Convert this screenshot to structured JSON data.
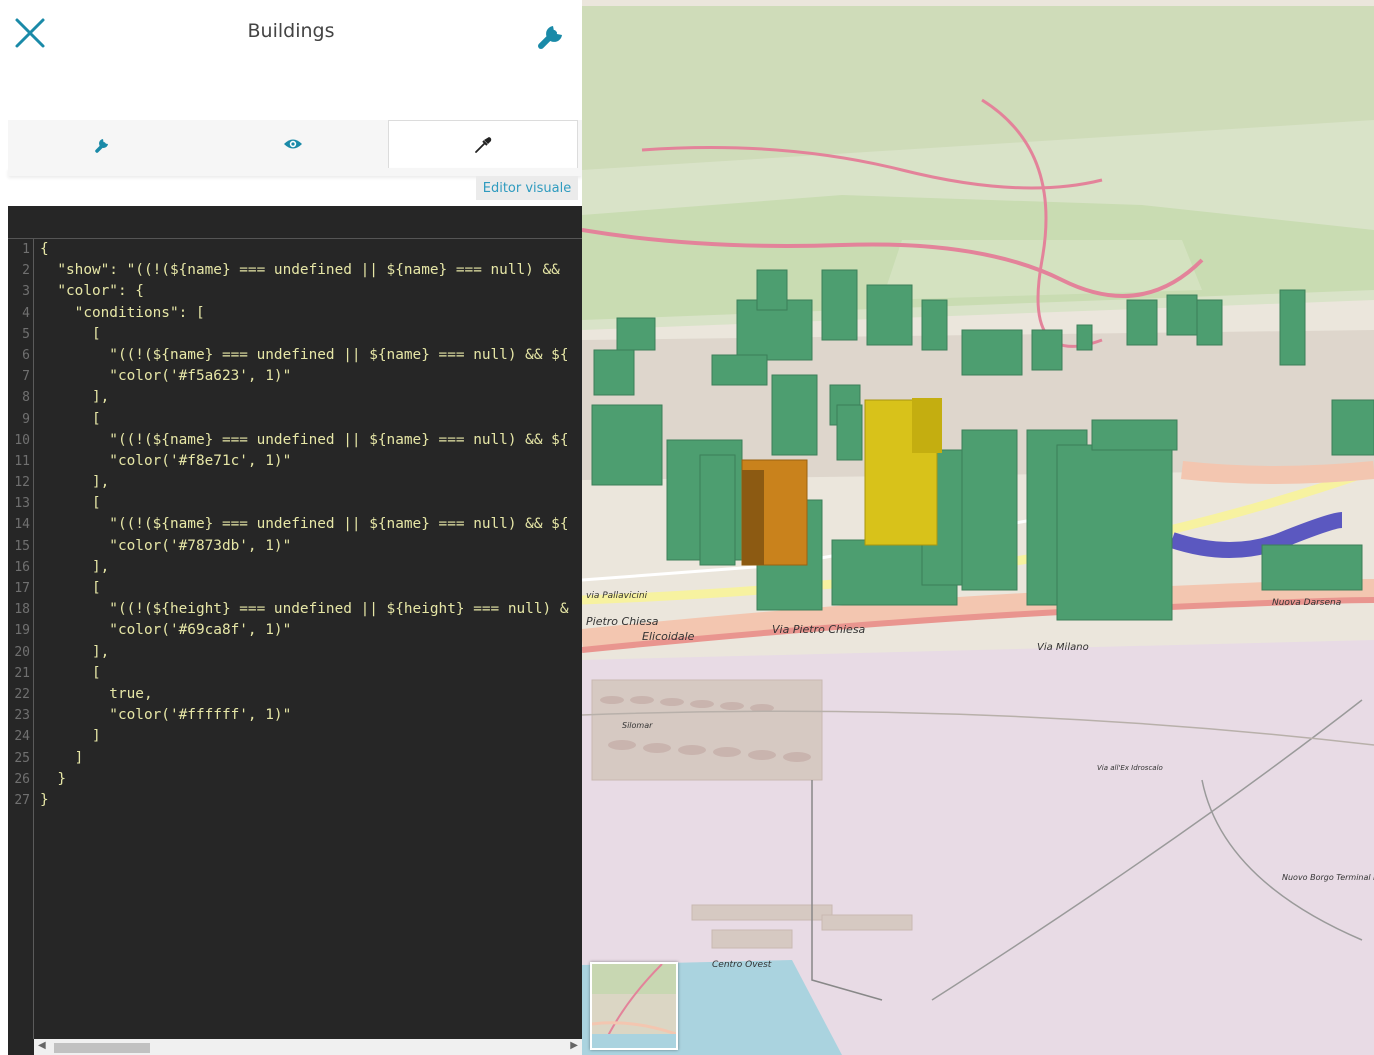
{
  "header": {
    "title": "Buildings",
    "close_icon": "close-icon",
    "settings_icon": "wrench-icon"
  },
  "tabs": [
    {
      "icon": "wrench-icon",
      "active": false
    },
    {
      "icon": "eye-icon",
      "active": false
    },
    {
      "icon": "eyedropper-icon",
      "active": true
    }
  ],
  "editor": {
    "visual_editor_label": "Editor visuale",
    "lines": [
      {
        "n": "1",
        "text": "{"
      },
      {
        "n": "2",
        "text": "  \"show\": \"((!(${name} === undefined || ${name} === null) && "
      },
      {
        "n": "3",
        "text": "  \"color\": {"
      },
      {
        "n": "4",
        "text": "    \"conditions\": ["
      },
      {
        "n": "5",
        "text": "      ["
      },
      {
        "n": "6",
        "text": "        \"((!(${name} === undefined || ${name} === null) && ${"
      },
      {
        "n": "7",
        "text": "        \"color('#f5a623', 1)\""
      },
      {
        "n": "8",
        "text": "      ],"
      },
      {
        "n": "9",
        "text": "      ["
      },
      {
        "n": "10",
        "text": "        \"((!(${name} === undefined || ${name} === null) && ${"
      },
      {
        "n": "11",
        "text": "        \"color('#f8e71c', 1)\""
      },
      {
        "n": "12",
        "text": "      ],"
      },
      {
        "n": "13",
        "text": "      ["
      },
      {
        "n": "14",
        "text": "        \"((!(${name} === undefined || ${name} === null) && ${"
      },
      {
        "n": "15",
        "text": "        \"color('#7873db', 1)\""
      },
      {
        "n": "16",
        "text": "      ],"
      },
      {
        "n": "17",
        "text": "      ["
      },
      {
        "n": "18",
        "text": "        \"((!(${height} === undefined || ${height} === null) &"
      },
      {
        "n": "19",
        "text": "        \"color('#69ca8f', 1)\""
      },
      {
        "n": "20",
        "text": "      ],"
      },
      {
        "n": "21",
        "text": "      ["
      },
      {
        "n": "22",
        "text": "        true,"
      },
      {
        "n": "23",
        "text": "        \"color('#ffffff', 1)\""
      },
      {
        "n": "24",
        "text": "      ]"
      },
      {
        "n": "25",
        "text": "    ]"
      },
      {
        "n": "26",
        "text": "  }"
      },
      {
        "n": "27",
        "text": "}"
      }
    ]
  },
  "map": {
    "labels": {
      "via_pietro_chiesa_1": "Pietro Chiesa",
      "via_pietro_chiesa_2": "Via Pietro Chiesa",
      "elicoidale": "Elicoidale",
      "via_milano": "Via Milano",
      "nuovo_borgo": "Nuovo Borgo Terminal Porto",
      "centro_ovest": "Centro Ovest",
      "darsena": "Nuova Darsena",
      "idroscalo": "Via all'Ex Idroscalo",
      "silomar": "Silomar",
      "pallavicini": "via Pallavicini"
    },
    "minimap_label": "minimap"
  },
  "colors": {
    "accent": "#1a8aa8",
    "editor_bg": "#262626",
    "code_text": "#e6e6a6",
    "building_default": "#4d9e70",
    "building_orange": "#c9821c",
    "building_yellow": "#d8c21a",
    "building_purple": "#5b58c0"
  }
}
